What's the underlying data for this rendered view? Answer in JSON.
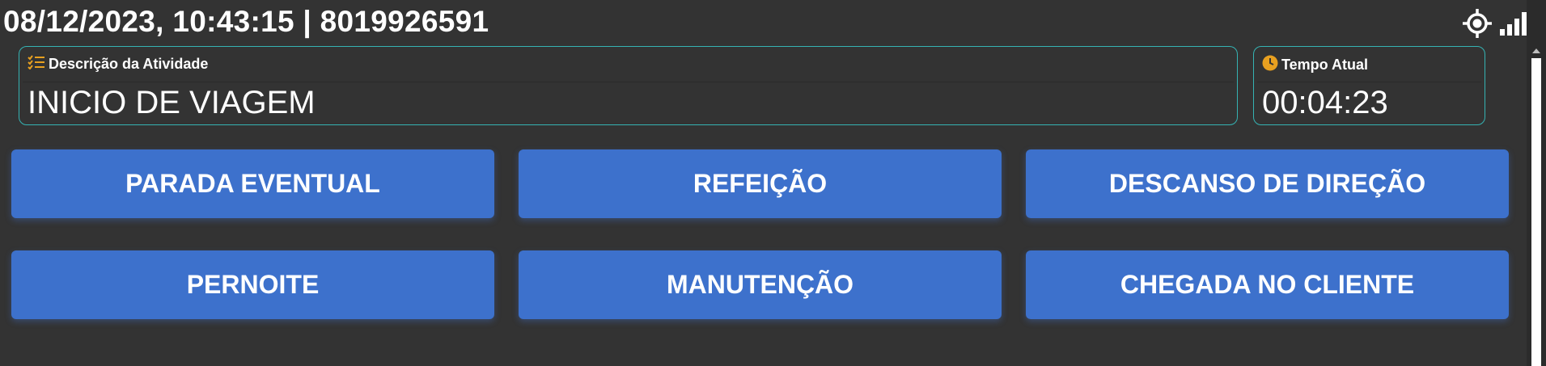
{
  "header": {
    "datetime_id": "08/12/2023, 10:43:15 | 8019926591"
  },
  "activity": {
    "label": "Descrição da Atividade",
    "value": "INICIO DE VIAGEM",
    "icon": "checklist-icon"
  },
  "time": {
    "label": "Tempo Atual",
    "value": "00:04:23",
    "icon": "clock-icon"
  },
  "actions": [
    {
      "label": "PARADA EVENTUAL"
    },
    {
      "label": "REFEIÇÃO"
    },
    {
      "label": "DESCANSO DE DIREÇÃO"
    },
    {
      "label": "PERNOITE"
    },
    {
      "label": "MANUTENÇÃO"
    },
    {
      "label": "CHEGADA NO CLIENTE"
    }
  ],
  "colors": {
    "background": "#333333",
    "button": "#3d71cc",
    "field_border": "#35b3b3",
    "icon_accent": "#e8a020"
  }
}
